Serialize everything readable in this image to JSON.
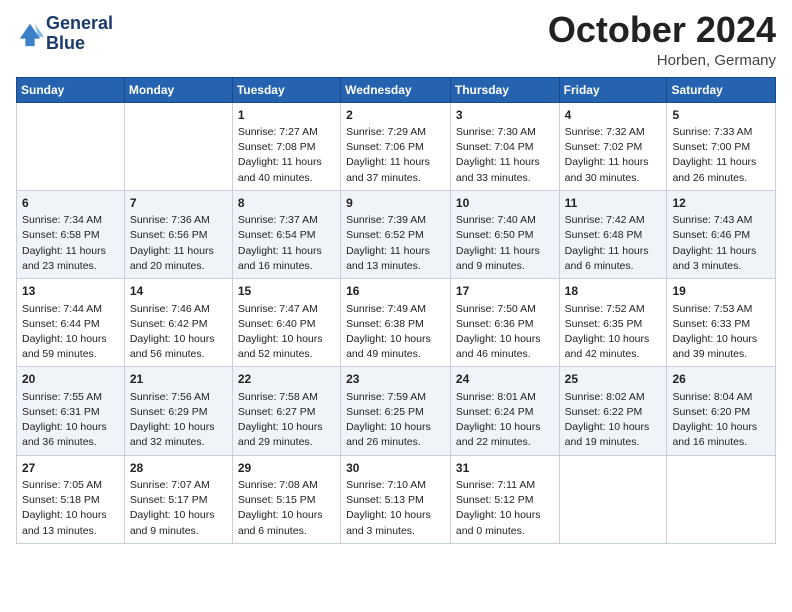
{
  "header": {
    "logo_line1": "General",
    "logo_line2": "Blue",
    "month": "October 2024",
    "location": "Horben, Germany"
  },
  "columns": [
    "Sunday",
    "Monday",
    "Tuesday",
    "Wednesday",
    "Thursday",
    "Friday",
    "Saturday"
  ],
  "weeks": [
    [
      {
        "day": "",
        "info": ""
      },
      {
        "day": "",
        "info": ""
      },
      {
        "day": "1",
        "info": "Sunrise: 7:27 AM\nSunset: 7:08 PM\nDaylight: 11 hours and 40 minutes."
      },
      {
        "day": "2",
        "info": "Sunrise: 7:29 AM\nSunset: 7:06 PM\nDaylight: 11 hours and 37 minutes."
      },
      {
        "day": "3",
        "info": "Sunrise: 7:30 AM\nSunset: 7:04 PM\nDaylight: 11 hours and 33 minutes."
      },
      {
        "day": "4",
        "info": "Sunrise: 7:32 AM\nSunset: 7:02 PM\nDaylight: 11 hours and 30 minutes."
      },
      {
        "day": "5",
        "info": "Sunrise: 7:33 AM\nSunset: 7:00 PM\nDaylight: 11 hours and 26 minutes."
      }
    ],
    [
      {
        "day": "6",
        "info": "Sunrise: 7:34 AM\nSunset: 6:58 PM\nDaylight: 11 hours and 23 minutes."
      },
      {
        "day": "7",
        "info": "Sunrise: 7:36 AM\nSunset: 6:56 PM\nDaylight: 11 hours and 20 minutes."
      },
      {
        "day": "8",
        "info": "Sunrise: 7:37 AM\nSunset: 6:54 PM\nDaylight: 11 hours and 16 minutes."
      },
      {
        "day": "9",
        "info": "Sunrise: 7:39 AM\nSunset: 6:52 PM\nDaylight: 11 hours and 13 minutes."
      },
      {
        "day": "10",
        "info": "Sunrise: 7:40 AM\nSunset: 6:50 PM\nDaylight: 11 hours and 9 minutes."
      },
      {
        "day": "11",
        "info": "Sunrise: 7:42 AM\nSunset: 6:48 PM\nDaylight: 11 hours and 6 minutes."
      },
      {
        "day": "12",
        "info": "Sunrise: 7:43 AM\nSunset: 6:46 PM\nDaylight: 11 hours and 3 minutes."
      }
    ],
    [
      {
        "day": "13",
        "info": "Sunrise: 7:44 AM\nSunset: 6:44 PM\nDaylight: 10 hours and 59 minutes."
      },
      {
        "day": "14",
        "info": "Sunrise: 7:46 AM\nSunset: 6:42 PM\nDaylight: 10 hours and 56 minutes."
      },
      {
        "day": "15",
        "info": "Sunrise: 7:47 AM\nSunset: 6:40 PM\nDaylight: 10 hours and 52 minutes."
      },
      {
        "day": "16",
        "info": "Sunrise: 7:49 AM\nSunset: 6:38 PM\nDaylight: 10 hours and 49 minutes."
      },
      {
        "day": "17",
        "info": "Sunrise: 7:50 AM\nSunset: 6:36 PM\nDaylight: 10 hours and 46 minutes."
      },
      {
        "day": "18",
        "info": "Sunrise: 7:52 AM\nSunset: 6:35 PM\nDaylight: 10 hours and 42 minutes."
      },
      {
        "day": "19",
        "info": "Sunrise: 7:53 AM\nSunset: 6:33 PM\nDaylight: 10 hours and 39 minutes."
      }
    ],
    [
      {
        "day": "20",
        "info": "Sunrise: 7:55 AM\nSunset: 6:31 PM\nDaylight: 10 hours and 36 minutes."
      },
      {
        "day": "21",
        "info": "Sunrise: 7:56 AM\nSunset: 6:29 PM\nDaylight: 10 hours and 32 minutes."
      },
      {
        "day": "22",
        "info": "Sunrise: 7:58 AM\nSunset: 6:27 PM\nDaylight: 10 hours and 29 minutes."
      },
      {
        "day": "23",
        "info": "Sunrise: 7:59 AM\nSunset: 6:25 PM\nDaylight: 10 hours and 26 minutes."
      },
      {
        "day": "24",
        "info": "Sunrise: 8:01 AM\nSunset: 6:24 PM\nDaylight: 10 hours and 22 minutes."
      },
      {
        "day": "25",
        "info": "Sunrise: 8:02 AM\nSunset: 6:22 PM\nDaylight: 10 hours and 19 minutes."
      },
      {
        "day": "26",
        "info": "Sunrise: 8:04 AM\nSunset: 6:20 PM\nDaylight: 10 hours and 16 minutes."
      }
    ],
    [
      {
        "day": "27",
        "info": "Sunrise: 7:05 AM\nSunset: 5:18 PM\nDaylight: 10 hours and 13 minutes."
      },
      {
        "day": "28",
        "info": "Sunrise: 7:07 AM\nSunset: 5:17 PM\nDaylight: 10 hours and 9 minutes."
      },
      {
        "day": "29",
        "info": "Sunrise: 7:08 AM\nSunset: 5:15 PM\nDaylight: 10 hours and 6 minutes."
      },
      {
        "day": "30",
        "info": "Sunrise: 7:10 AM\nSunset: 5:13 PM\nDaylight: 10 hours and 3 minutes."
      },
      {
        "day": "31",
        "info": "Sunrise: 7:11 AM\nSunset: 5:12 PM\nDaylight: 10 hours and 0 minutes."
      },
      {
        "day": "",
        "info": ""
      },
      {
        "day": "",
        "info": ""
      }
    ]
  ]
}
